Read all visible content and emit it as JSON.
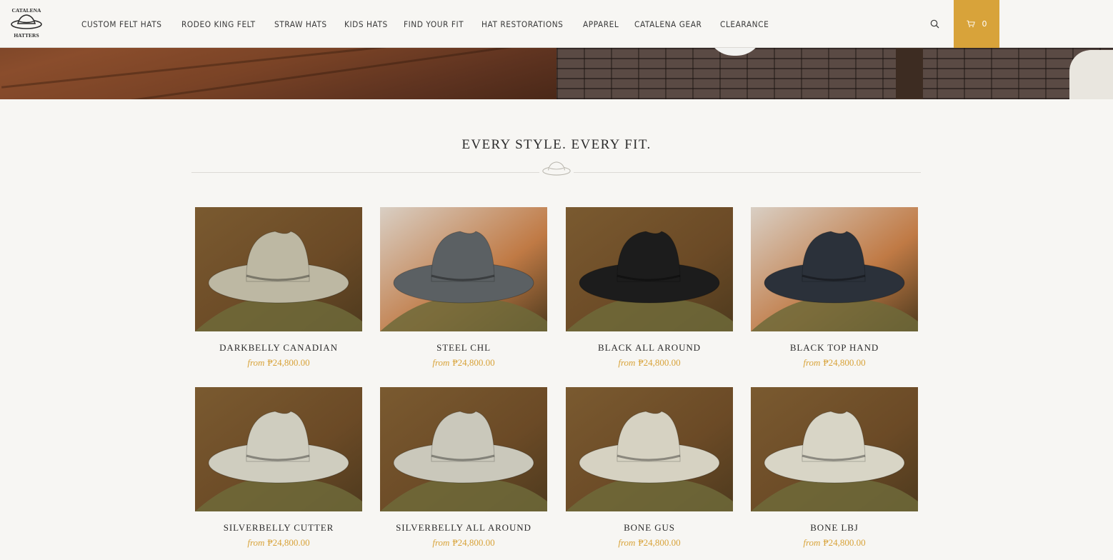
{
  "brand": {
    "logo_text": [
      "CATALENA",
      "HATTERS"
    ]
  },
  "nav": {
    "items": [
      "CUSTOM FELT HATS",
      "RODEO KING FELT",
      "STRAW HATS",
      "KIDS HATS",
      "FIND YOUR FIT",
      "HAT RESTORATIONS",
      "APPAREL",
      "CATALENA GEAR",
      "CLEARANCE"
    ],
    "search_icon": "search-icon",
    "cart": {
      "icon": "cart-icon",
      "count": "0"
    }
  },
  "section": {
    "title": "EVERY STYLE. EVERY FIT.",
    "divider_icon": "cowboy-hat-icon"
  },
  "colors": {
    "accent": "#d8a33a",
    "background": "#f7f6f3",
    "text": "#2b2b2b"
  },
  "products": [
    {
      "name": "DARKBELLY CANADIAN",
      "from_label": "from",
      "price": "₱24,800.00",
      "hat_color": "#bdb8a3"
    },
    {
      "name": "STEEL CHL",
      "from_label": "from",
      "price": "₱24,800.00",
      "hat_color": "#5b6063"
    },
    {
      "name": "BLACK ALL AROUND",
      "from_label": "from",
      "price": "₱24,800.00",
      "hat_color": "#1c1c1c"
    },
    {
      "name": "BLACK TOP HAND",
      "from_label": "from",
      "price": "₱24,800.00",
      "hat_color": "#2b313a"
    },
    {
      "name": "SILVERBELLY CUTTER",
      "from_label": "from",
      "price": "₱24,800.00",
      "hat_color": "#cfcdbf"
    },
    {
      "name": "SILVERBELLY ALL AROUND",
      "from_label": "from",
      "price": "₱24,800.00",
      "hat_color": "#cac8bb"
    },
    {
      "name": "BONE GUS",
      "from_label": "from",
      "price": "₱24,800.00",
      "hat_color": "#d6d2c2"
    },
    {
      "name": "BONE LBJ",
      "from_label": "from",
      "price": "₱24,800.00",
      "hat_color": "#d8d5c6"
    }
  ]
}
